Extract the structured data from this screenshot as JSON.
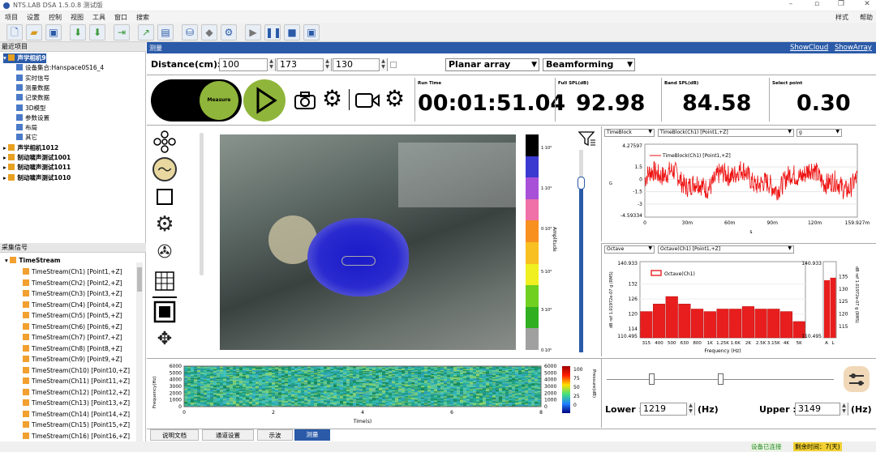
{
  "window": {
    "title": "NTS.LAB DSA 1.5.0.8 测试版",
    "skin_label": "样式",
    "help_label": "帮助"
  },
  "menu": [
    "项目",
    "设置",
    "控制",
    "视图",
    "工具",
    "窗口",
    "搜索"
  ],
  "project_panel": {
    "title": "最近项目",
    "items": [
      {
        "label": "声学相机9",
        "level": 0,
        "selected": true
      },
      {
        "label": "设备集合:Hanspace0S16_4",
        "level": 1
      },
      {
        "label": "实时信号",
        "level": 1
      },
      {
        "label": "测量数据",
        "level": 1
      },
      {
        "label": "记录数据",
        "level": 1
      },
      {
        "label": "3D模型",
        "level": 1
      },
      {
        "label": "参数设置",
        "level": 1
      },
      {
        "label": "布局",
        "level": 1
      },
      {
        "label": "其它",
        "level": 1
      },
      {
        "label": "声学相机1012",
        "level": 0
      },
      {
        "label": "制动啸声测试1001",
        "level": 0
      },
      {
        "label": "制动啸声测试1011",
        "level": 0
      },
      {
        "label": "制动啸声测试1010",
        "level": 0
      }
    ]
  },
  "signal_panel": {
    "title": "采集信号",
    "root": "TimeStream",
    "items": [
      "TimeStream(Ch1) [Point1,+Z]",
      "TimeStream(Ch2) [Point2,+Z]",
      "TimeStream(Ch3) [Point3,+Z]",
      "TimeStream(Ch4) [Point4,+Z]",
      "TimeStream(Ch5) [Point5,+Z]",
      "TimeStream(Ch6) [Point6,+Z]",
      "TimeStream(Ch7) [Point7,+Z]",
      "TimeStream(Ch8) [Point8,+Z]",
      "TimeStream(Ch9) [Point9,+Z]",
      "TimeStream(Ch10) [Point10,+Z]",
      "TimeStream(Ch11) [Point11,+Z]",
      "TimeStream(Ch12) [Point12,+Z]",
      "TimeStream(Ch13) [Point13,+Z]",
      "TimeStream(Ch14) [Point14,+Z]",
      "TimeStream(Ch15) [Point15,+Z]",
      "TimeStream(Ch16) [Point16,+Z]"
    ]
  },
  "main": {
    "header_title": "测量",
    "show_cloud": "ShowCloud",
    "show_array": "ShowArray",
    "distance_label": "Distance(cm):",
    "distance_values": [
      "100",
      "173",
      "130"
    ],
    "array_type": "Planar array",
    "algorithm": "Beamforming",
    "measure_label": "Measure",
    "metrics": [
      {
        "title": "Run Time",
        "value": "00:01:51.04"
      },
      {
        "title": "Full SPL(dB)",
        "value": "92.98"
      },
      {
        "title": "Band SPL(dB)",
        "value": "84.58"
      },
      {
        "title": "Select point",
        "value": "0.30"
      }
    ],
    "legend": {
      "title": "Amplitude",
      "labels": [
        "1·10⁴",
        "1·10⁴",
        "1·10⁴",
        "0·10³",
        "5·10³",
        "3·10³",
        "3·10³",
        "0·10⁰"
      ]
    },
    "timeblock": {
      "dd1": "TimeBlock",
      "dd2": "TimeBlock(Ch1) [Point1,+Z]",
      "dd3": "g",
      "ymax": "4.27597",
      "ymin": "-4.59334",
      "yticks": [
        "1.5",
        "0",
        "-1.5",
        "-3"
      ],
      "ylabel": "G",
      "xticks": [
        "0",
        "30m",
        "60m",
        "90m",
        "120m",
        "159.927m"
      ],
      "xlabel": "s",
      "legend": "TimeBlock(Ch1) [Point1,+Z]"
    },
    "octave": {
      "dd1": "Octave",
      "dd2": "Octave(Ch1) [Point1,+Z]",
      "ymax": "140.933",
      "ymin": "110.495",
      "yticks": [
        "132",
        "126",
        "120",
        "114"
      ],
      "ylabel": "dB ref 1.01972e-07 g (RMS)",
      "legend": "Octave(Ch1)",
      "xticks": [
        "315",
        "400",
        "500",
        "630",
        "800",
        "1K",
        "1.25K",
        "1.6K",
        "2K",
        "2.5K",
        "3.15K",
        "4K",
        "5K"
      ],
      "xlabel": "Frequency (Hz)",
      "right_ymax": "140.933",
      "right_ymin": "110.495",
      "right_yticks": [
        "135",
        "130",
        "125",
        "120",
        "115"
      ],
      "right_ylabel": "dB ref 1.01972e-07 g (RMS)",
      "right_xticks": [
        "A",
        "L"
      ]
    },
    "spectrogram": {
      "ylabel": "Frequency(Hz)",
      "yticks": [
        "6000",
        "5000",
        "4000",
        "3000",
        "2000",
        "1000",
        "0"
      ],
      "xticks": [
        "0",
        "2",
        "4",
        "6",
        "8"
      ],
      "xlabel": "Time(s)",
      "right_yticks": [
        "6000",
        "5000",
        "4000",
        "3000",
        "2000",
        "1000",
        "0"
      ],
      "cbar_ticks": [
        "100",
        "75",
        "50",
        "25",
        "0"
      ],
      "cbar_label": "Pressure(dB)"
    },
    "band": {
      "lower_label": "Lower :",
      "lower_value": "1219",
      "upper_label": "Upper :",
      "upper_value": "3149",
      "unit": "(Hz)"
    },
    "tabs": [
      "说明文档",
      "通道设置",
      "示波",
      "测量"
    ]
  },
  "status": {
    "left": "设备已连接",
    "right": "剩余时间：7(天)"
  },
  "chart_data": [
    {
      "type": "line",
      "title": "",
      "xlabel": "s",
      "ylabel": "G",
      "ylim": [
        -4.59334,
        4.27597
      ],
      "xlim": [
        0,
        0.159927
      ],
      "series": [
        {
          "name": "TimeBlock(Ch1) [Point1,+Z]",
          "values": []
        }
      ]
    },
    {
      "type": "bar",
      "categories": [
        "315",
        "400",
        "500",
        "630",
        "800",
        "1K",
        "1.25K",
        "1.6K",
        "2K",
        "2.5K",
        "3.15K",
        "4K",
        "5K"
      ],
      "values": [
        121,
        124,
        127,
        124,
        122,
        121,
        122,
        122,
        123,
        122,
        122,
        121,
        117
      ],
      "xlabel": "Frequency (Hz)",
      "ylabel": "dB ref 1.01972e-07 g (RMS)",
      "ylim": [
        110.495,
        140.933
      ],
      "series": [
        {
          "name": "Octave(Ch1)",
          "values": [
            121,
            124,
            127,
            124,
            122,
            121,
            122,
            122,
            123,
            122,
            122,
            121,
            117
          ]
        }
      ]
    },
    {
      "type": "bar",
      "categories": [
        "A",
        "L"
      ],
      "values": [
        133.5,
        134.5
      ],
      "ylim": [
        110.495,
        140.933
      ]
    }
  ],
  "colors": {
    "accent": "#2a5aa8",
    "measure_green": "#8fb53a",
    "bar_red": "#e81e1e",
    "line_red": "#ee1111"
  }
}
